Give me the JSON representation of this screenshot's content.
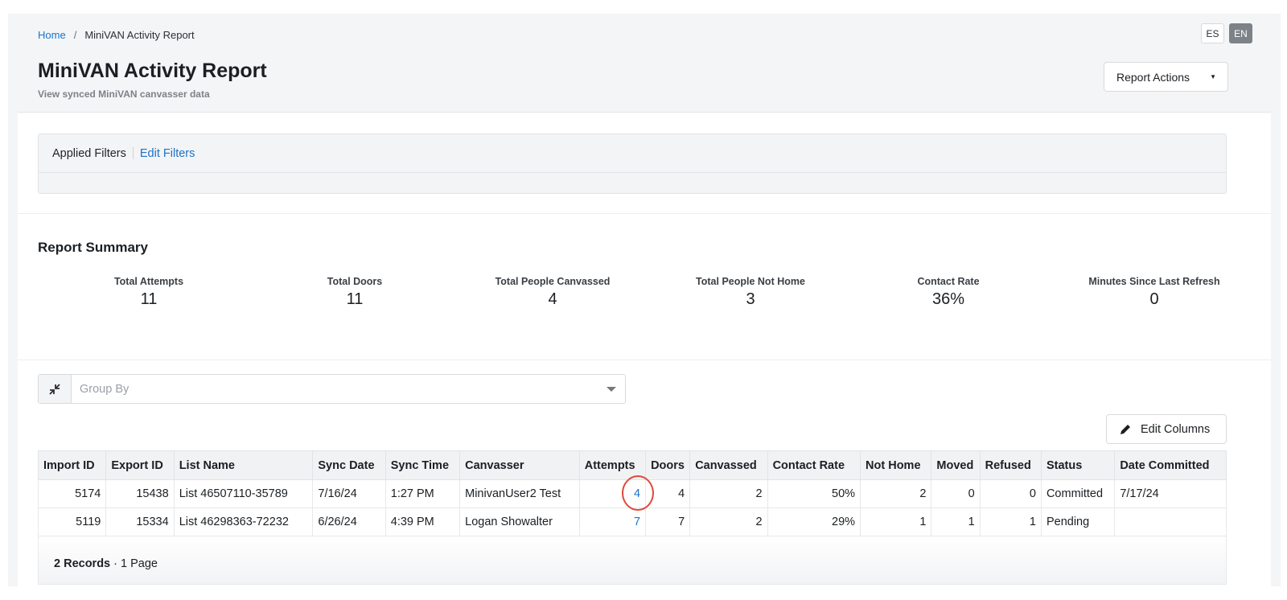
{
  "header": {
    "breadcrumb": {
      "home": "Home",
      "separator": "/",
      "current": "MiniVAN Activity Report"
    },
    "title": "MiniVAN Activity Report",
    "subtitle": "View synced MiniVAN canvasser data",
    "languages": {
      "es": "ES",
      "en": "EN",
      "active": "EN"
    },
    "report_actions_label": "Report Actions"
  },
  "filters": {
    "label": "Applied Filters",
    "edit_label": "Edit Filters"
  },
  "summary": {
    "title": "Report Summary",
    "stats": [
      {
        "label": "Total Attempts",
        "value": "11"
      },
      {
        "label": "Total Doors",
        "value": "11"
      },
      {
        "label": "Total People Canvassed",
        "value": "4"
      },
      {
        "label": "Total People Not Home",
        "value": "3"
      },
      {
        "label": "Contact Rate",
        "value": "36%"
      },
      {
        "label": "Minutes Since Last Refresh",
        "value": "0"
      }
    ]
  },
  "group_by": {
    "placeholder": "Group By"
  },
  "edit_columns_label": "Edit Columns",
  "table": {
    "columns": [
      "Import ID",
      "Export ID",
      "List Name",
      "Sync Date",
      "Sync Time",
      "Canvasser",
      "Attempts",
      "Doors",
      "Canvassed",
      "Contact Rate",
      "Not Home",
      "Moved",
      "Refused",
      "Status",
      "Date Committed"
    ],
    "rows": [
      {
        "import_id": "5174",
        "export_id": "15438",
        "list_name": "List 46507110-35789",
        "sync_date": "7/16/24",
        "sync_time": "1:27 PM",
        "canvasser": "MinivanUser2 Test",
        "attempts": "4",
        "doors": "4",
        "canvassed": "2",
        "contact_rate": "50%",
        "not_home": "2",
        "moved": "0",
        "refused": "0",
        "status": "Committed",
        "date_committed": "7/17/24"
      },
      {
        "import_id": "5119",
        "export_id": "15334",
        "list_name": "List 46298363-72232",
        "sync_date": "6/26/24",
        "sync_time": "4:39 PM",
        "canvasser": "Logan Showalter",
        "attempts": "7",
        "doors": "7",
        "canvassed": "2",
        "contact_rate": "29%",
        "not_home": "1",
        "moved": "1",
        "refused": "1",
        "status": "Pending",
        "date_committed": ""
      }
    ]
  },
  "footer": {
    "records": "2 Records",
    "separator": "·",
    "pages": "1 Page"
  },
  "colors": {
    "link": "#1a73c9",
    "highlight_ring": "#e0493a",
    "active_lang": "#7c8287"
  },
  "icons": {
    "collapse": "collapse-arrows-icon",
    "pencil": "pencil-icon",
    "caret": "caret-down-icon"
  }
}
